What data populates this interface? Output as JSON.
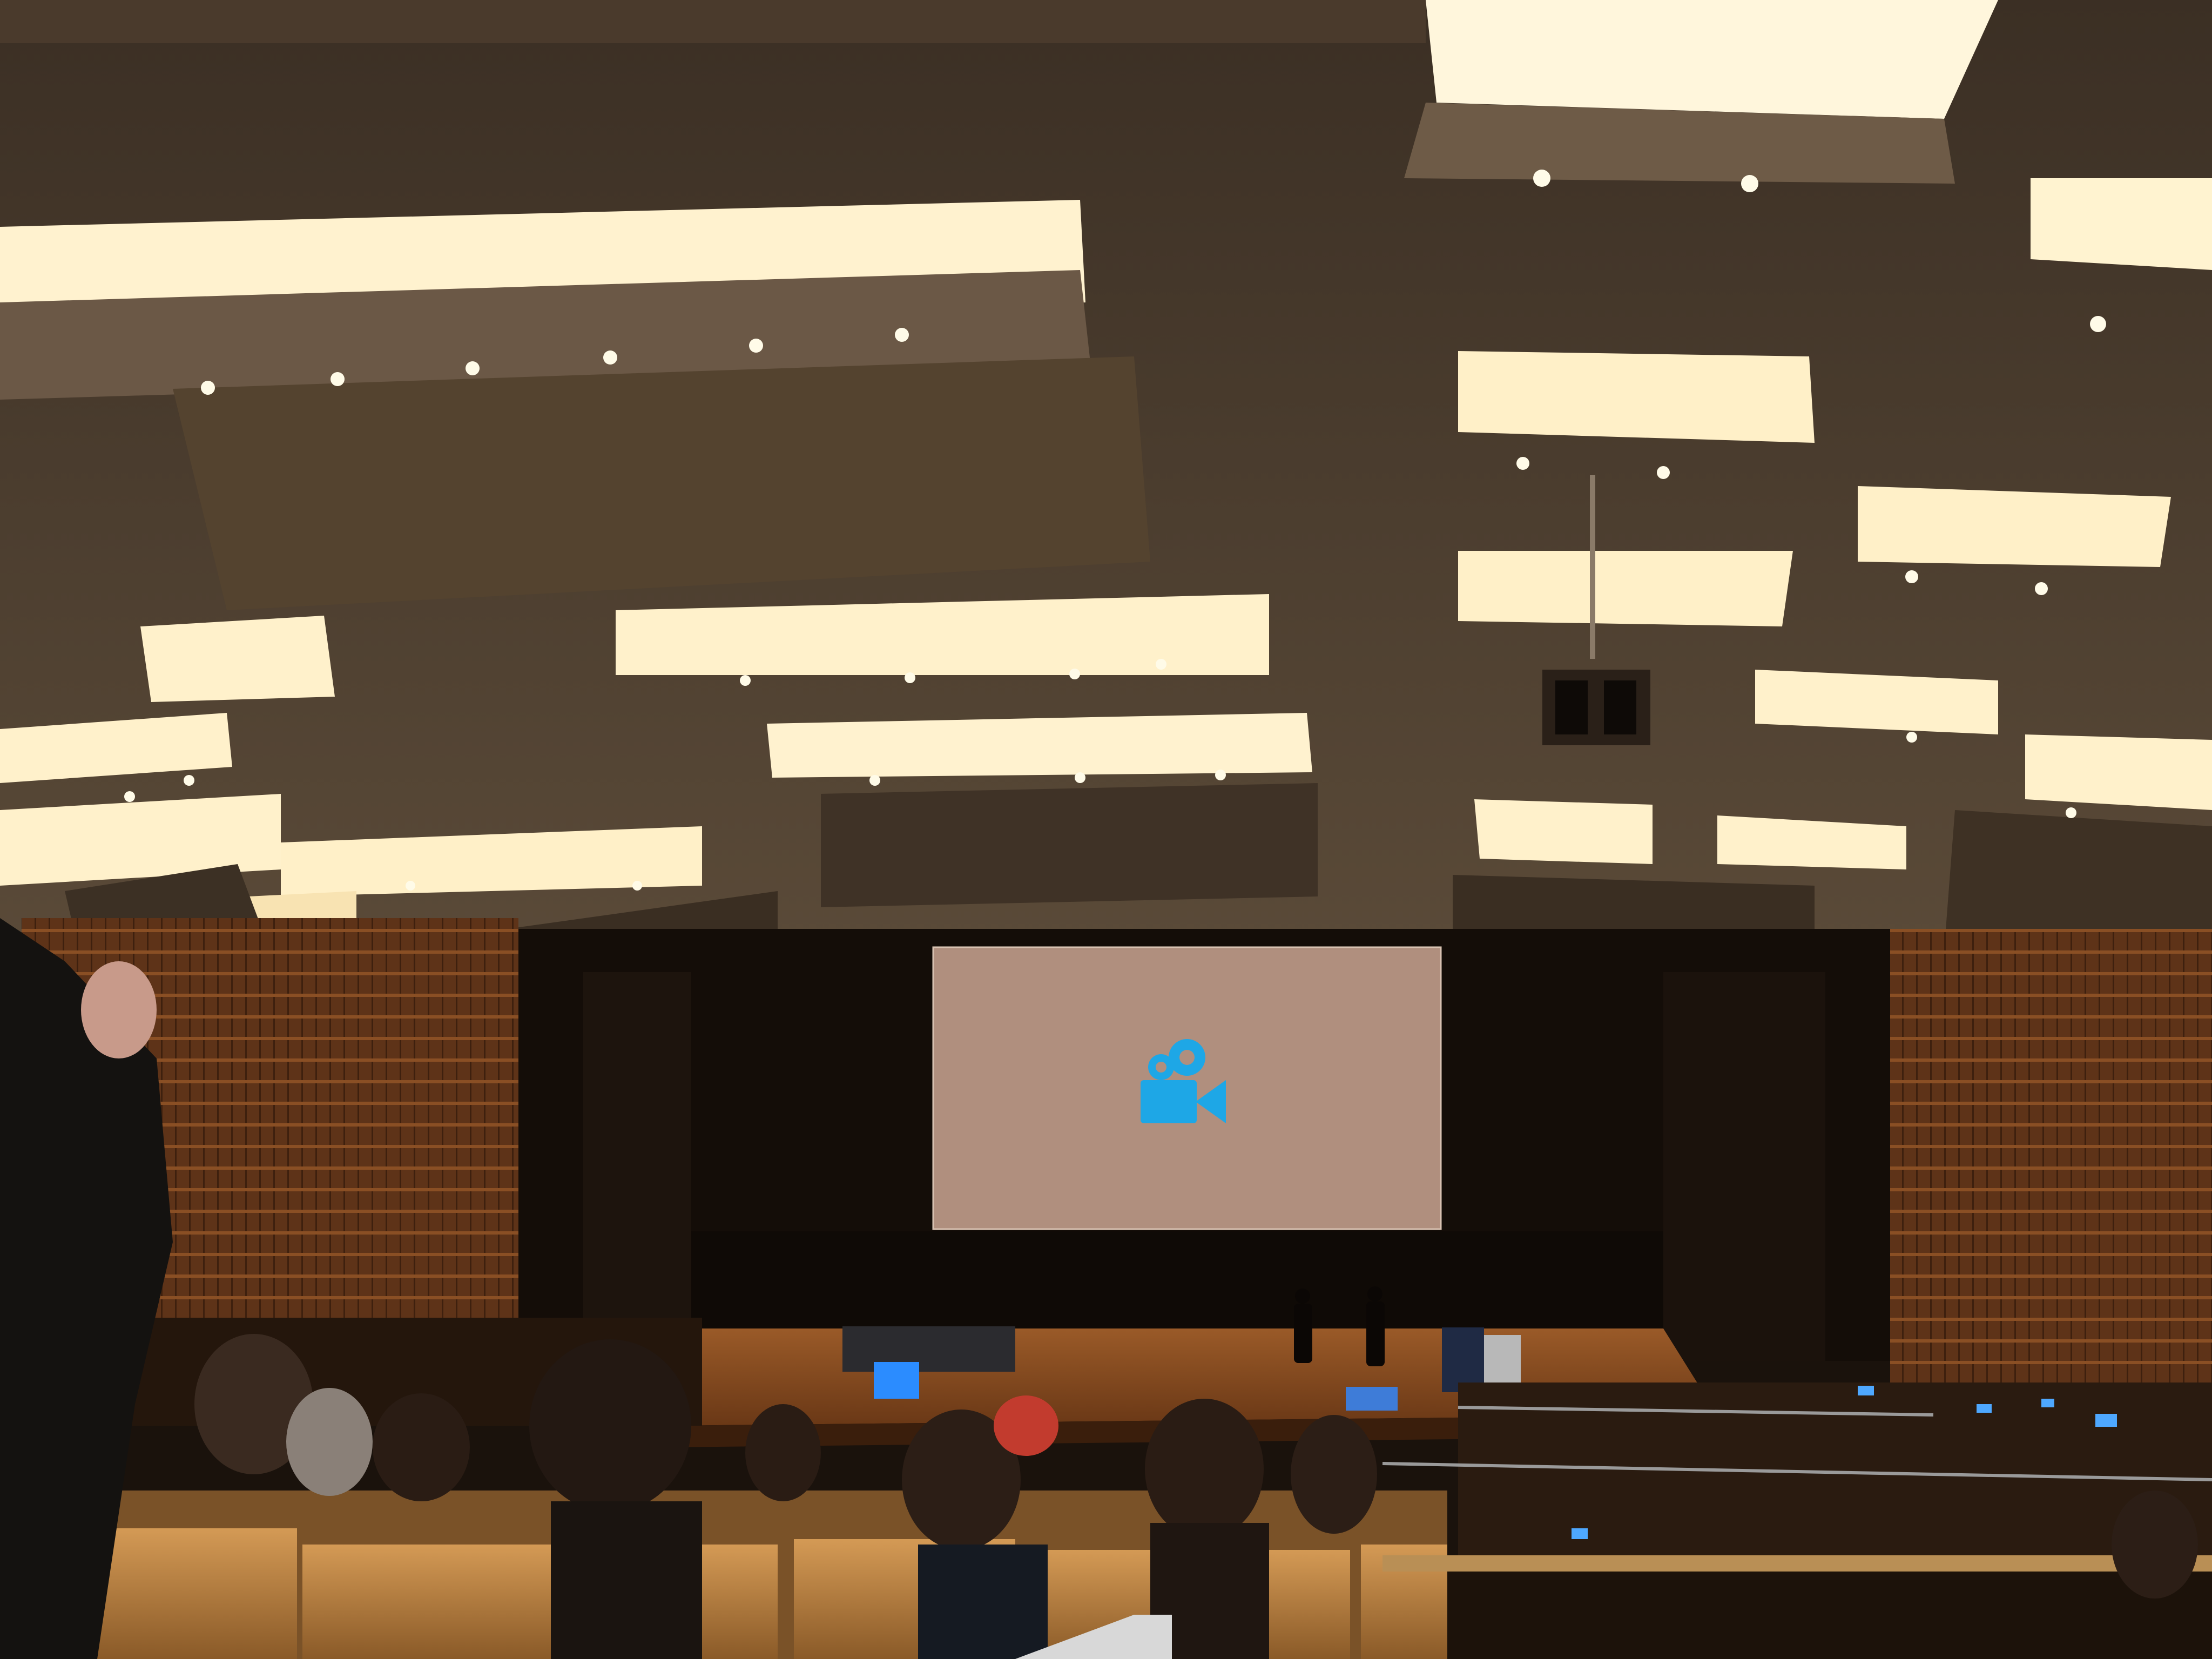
{
  "scene": {
    "subject": "lecture-hall-with-stage-and-projection-screen",
    "colors": {
      "ceiling": "#6b5a44",
      "ceiling_dark": "#2e241a",
      "light_strip": "#fff4d6",
      "wood_wall": "#6a3a1c",
      "curtain": "#120c08",
      "screen": "#b08f7e",
      "stage": "#8a4e22",
      "seat": "#c88a45",
      "camera_icon": "#1ea7e6",
      "monitor": "#2b8cff"
    },
    "screen_icon": "video-camera-icon"
  }
}
